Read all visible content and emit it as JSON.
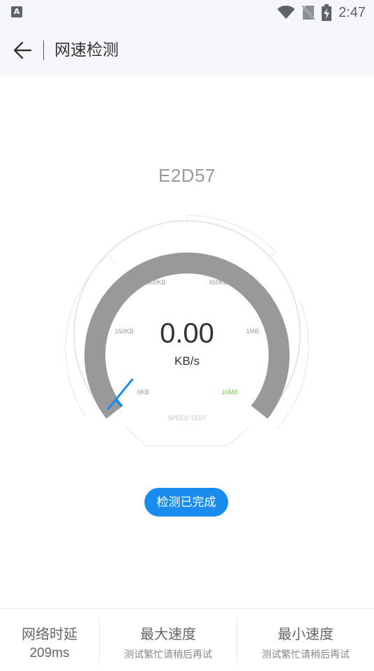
{
  "status_bar": {
    "left_icon_letter": "A",
    "time": "2:47",
    "icons": [
      "wifi-icon",
      "sim-off-icon",
      "battery-charging-icon"
    ]
  },
  "header": {
    "back_icon": "arrow-left-icon",
    "title": "网速检测"
  },
  "device": {
    "name": "E2D57"
  },
  "gauge": {
    "labels": {
      "l0": "0KB",
      "l150": "150KB",
      "l300": "300KB",
      "l450": "450KB",
      "l1mb": "1MB",
      "l10mb": "10MB",
      "speed_test": "SPEED TEST"
    },
    "progress_fraction": 0.02,
    "colors": {
      "track": "#999999",
      "needle": "#1a8cf0",
      "accent_label": "#7ac943"
    }
  },
  "speed": {
    "value": "0.00",
    "unit": "KB/s"
  },
  "status_button": {
    "label": "检测已完成"
  },
  "stats": {
    "latency_title": "网络时延",
    "latency_value": "209ms",
    "max_title": "最大速度",
    "max_value": "测试繁忙请稍后再试",
    "min_title": "最小速度",
    "min_value": "测试繁忙请稍后再试"
  }
}
